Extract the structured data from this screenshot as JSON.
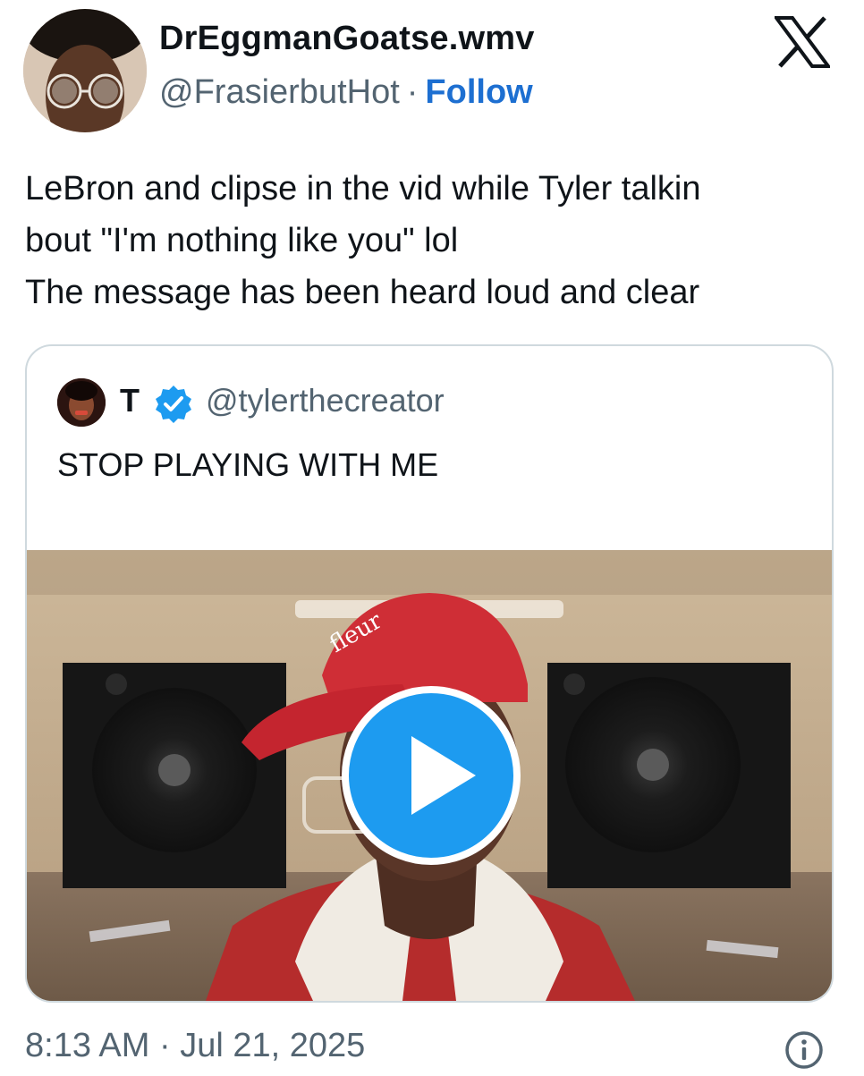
{
  "author": {
    "display_name": "DrEggmanGoatse.wmv",
    "handle": "@FrasierbutHot",
    "separator": "·",
    "follow_label": "Follow"
  },
  "brand": {
    "logo_icon": "x-logo-icon"
  },
  "tweet": {
    "lines": [
      "LeBron and clipse in the vid while Tyler talkin",
      "bout \"I'm nothing like you\" lol",
      "The message has been heard loud and clear"
    ]
  },
  "quoted": {
    "name": "T",
    "verified_icon": "verified-badge-icon",
    "handle": "@tylerthecreator",
    "text": "STOP PLAYING WITH ME",
    "media": {
      "type": "video",
      "play_icon": "play-icon"
    }
  },
  "footer": {
    "timestamp": "8:13 AM · Jul 21, 2025",
    "info_icon": "info-icon"
  },
  "colors": {
    "accent": "#1d6fd1",
    "play": "#1d9bf0",
    "secondary_text": "#536471",
    "border": "#cfd9de"
  }
}
